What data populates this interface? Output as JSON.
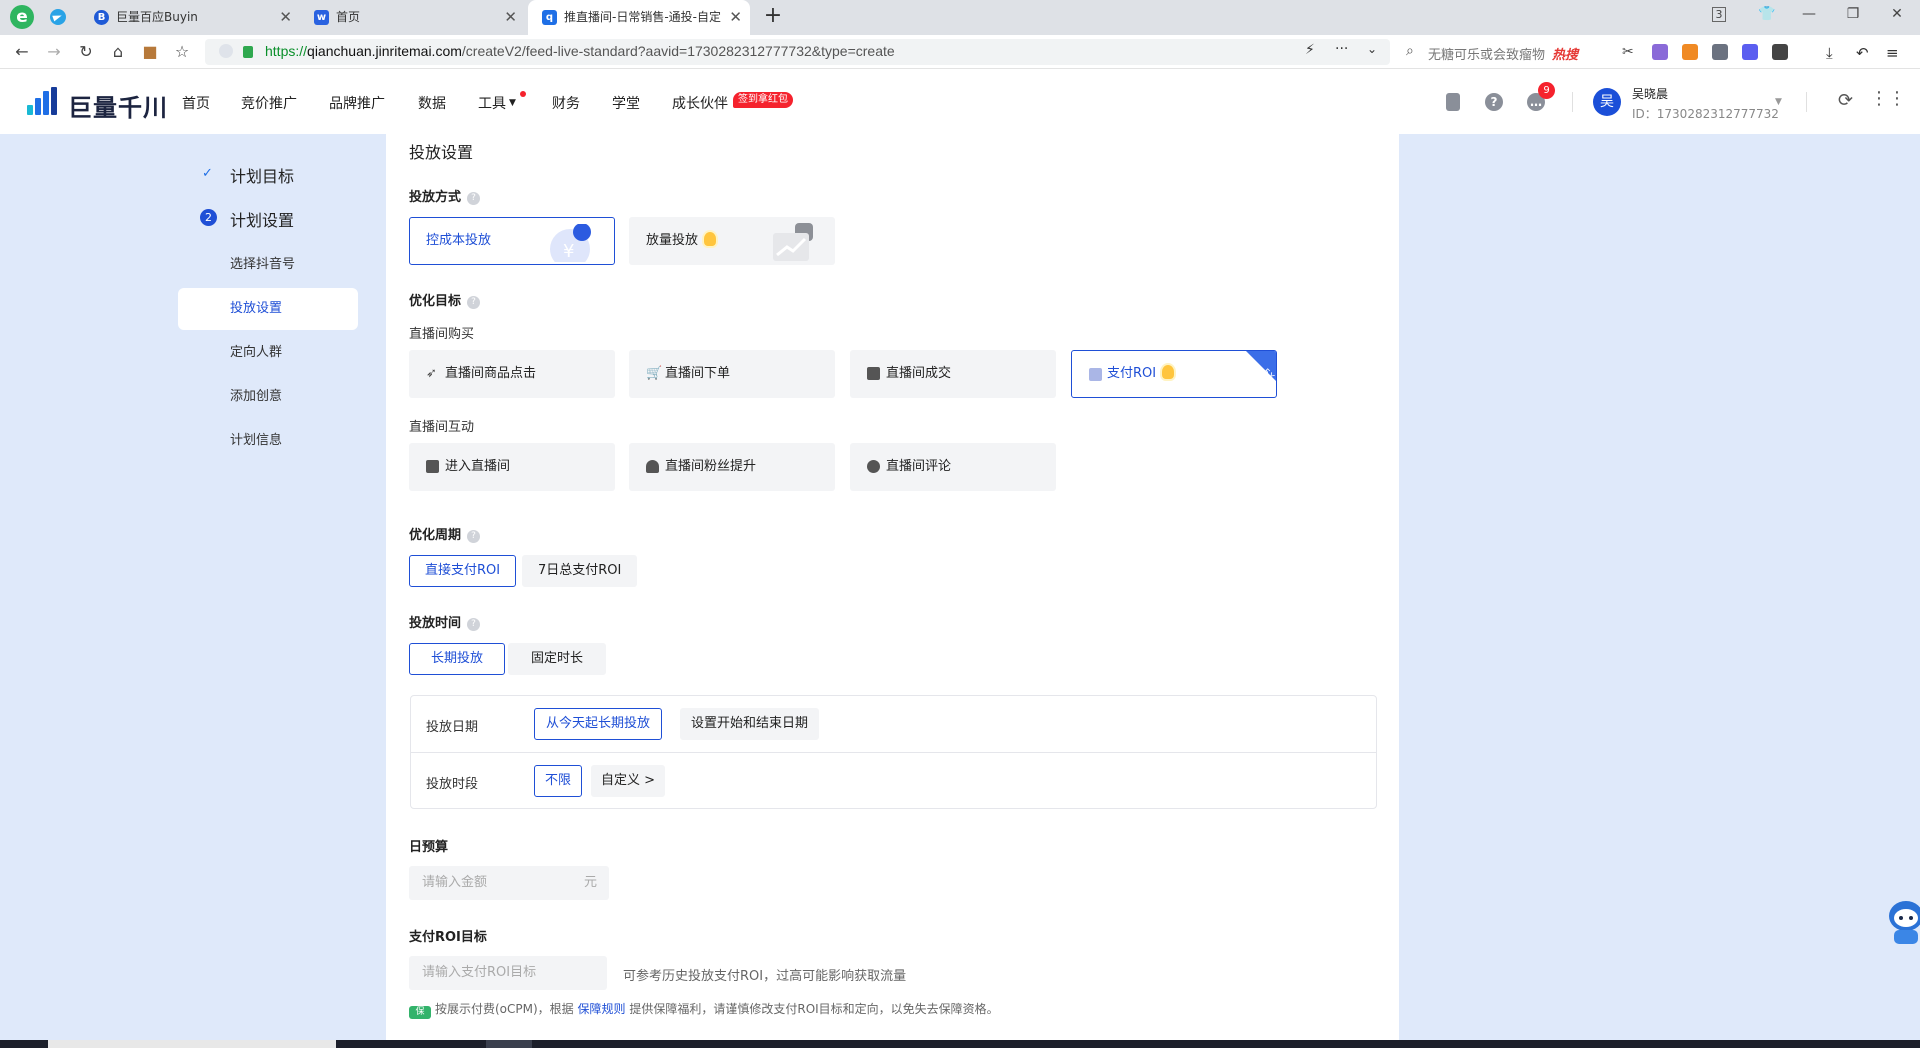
{
  "browser": {
    "tabs": [
      {
        "title": "巨量百应Buyin",
        "fav": "B"
      },
      {
        "title": "首页",
        "fav": "w"
      },
      {
        "title": "推直播间-日常销售-通投-自定",
        "fav": "q"
      }
    ],
    "tab_count": "3",
    "url_scheme": "https://",
    "url_domain": "qianchuan.jinritemai.com",
    "url_path": "/createV2/feed-live-standard?aavid=1730282312777732&type=create",
    "search_placeholder": "无糖可乐或会致瘤物",
    "search_hot": "热搜"
  },
  "header": {
    "logo_text": "巨量千川",
    "nav": [
      "首页",
      "竞价推广",
      "品牌推广",
      "数据",
      "工具",
      "财务",
      "学堂",
      "成长伙伴"
    ],
    "nav_badge": "签到拿红包",
    "msg_count": "9",
    "avatar_char": "吴",
    "user_name": "吴晓晨",
    "user_id": "ID：1730282312777732"
  },
  "sidebar": {
    "steps": [
      {
        "label": "计划目标",
        "marker": "✓"
      },
      {
        "label": "计划设置",
        "marker": "2"
      }
    ],
    "items": [
      "选择抖音号",
      "投放设置",
      "定向人群",
      "添加创意",
      "计划信息"
    ]
  },
  "form": {
    "section_title": "投放设置",
    "delivery_mode": {
      "label": "投放方式",
      "options": [
        "控成本投放",
        "放量投放"
      ]
    },
    "opt_goal": {
      "label": "优化目标",
      "group1": "直播间购买",
      "group1_options": [
        "直播间商品点击",
        "直播间下单",
        "直播间成交",
        "支付ROI"
      ],
      "corner_tag": "5X",
      "group2": "直播间互动",
      "group2_options": [
        "进入直播间",
        "直播间粉丝提升",
        "直播间评论"
      ]
    },
    "opt_period": {
      "label": "优化周期",
      "options": [
        "直接支付ROI",
        "7日总支付ROI"
      ]
    },
    "time": {
      "label": "投放时间",
      "options": [
        "长期投放",
        "固定时长"
      ],
      "date_label": "投放日期",
      "date_options": [
        "从今天起长期投放",
        "设置开始和结束日期"
      ],
      "slot_label": "投放时段",
      "slot_options": [
        "不限",
        "自定义 >"
      ]
    },
    "budget": {
      "label": "日预算",
      "placeholder": "请输入金额",
      "unit": "元"
    },
    "roi": {
      "label": "支付ROI目标",
      "placeholder": "请输入支付ROI目标",
      "hint": "可参考历史投放支付ROI，过高可能影响获取流量",
      "shield": "保",
      "note_a": "按展示付费(oCPM)，根据",
      "note_link": "保障规则",
      "note_b": "提供保障福利，请谨慎修改支付ROI目标和定向，以免失去保障资格。"
    }
  },
  "colors": {
    "accent": "#1f4fd6",
    "page_bg": "#dfe9fa",
    "badge_red": "#f5222d"
  }
}
